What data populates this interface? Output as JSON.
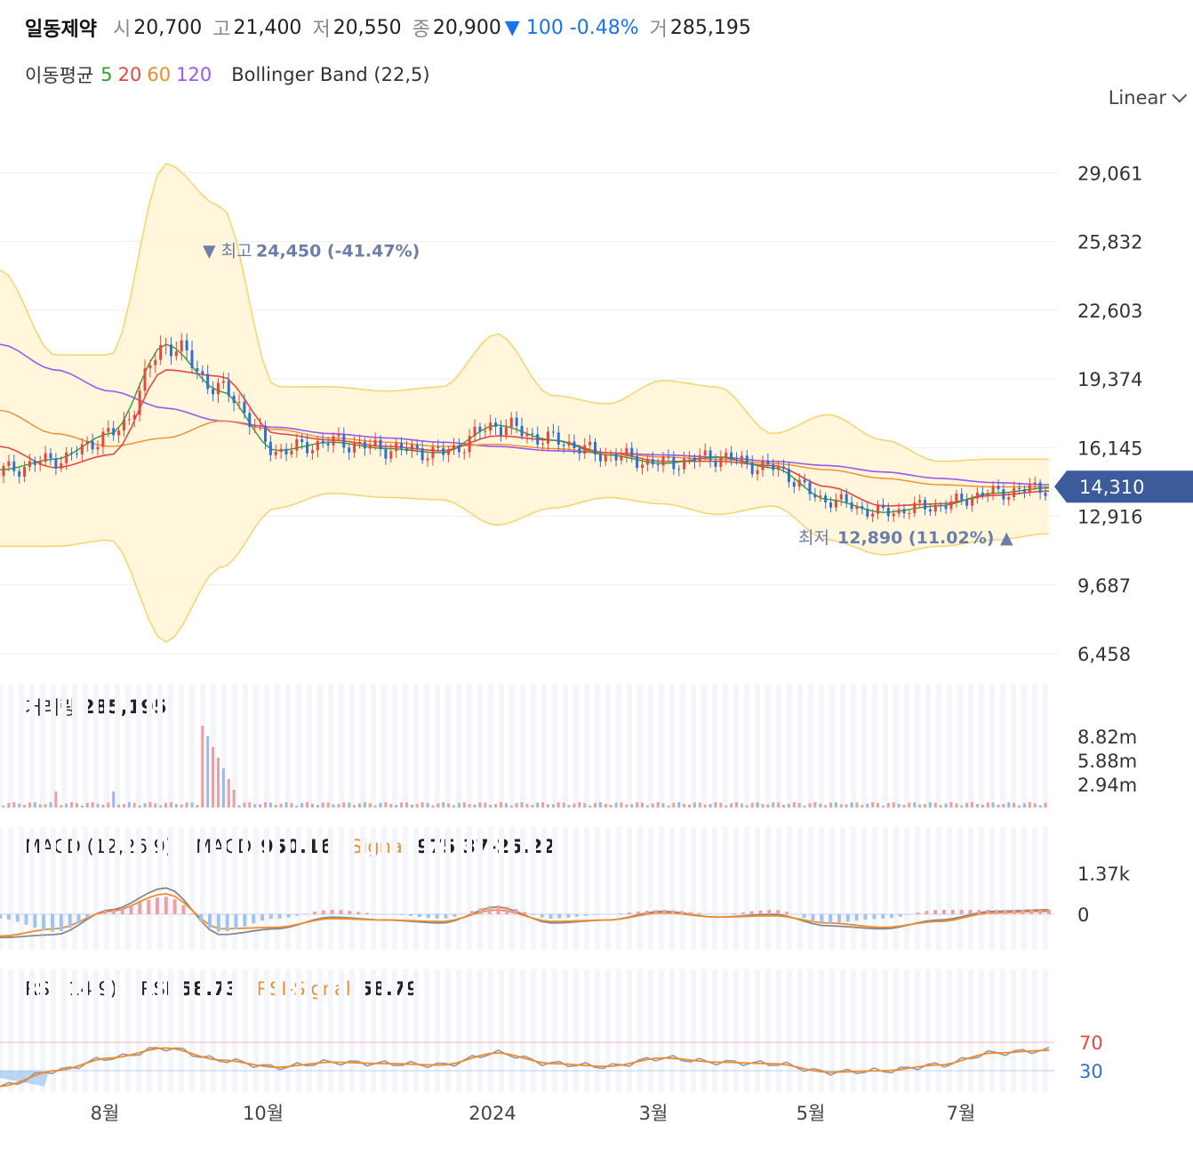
{
  "header": {
    "name": "일동제약",
    "open_label": "시",
    "open": "20,700",
    "high_label": "고",
    "high": "21,400",
    "low_label": "저",
    "low": "20,550",
    "close_label": "종",
    "close": "20,900",
    "change": "▼ 100 -0.48%",
    "volume_label": "거",
    "volume": "285,195"
  },
  "indicators": {
    "ma_label": "이동평균",
    "ma_periods": [
      "5",
      "20",
      "60",
      "120"
    ],
    "bollinger": "Bollinger Band (22,5)"
  },
  "scale_selector": "Linear",
  "colors": {
    "up": "#e8473f",
    "down": "#2f6fd6",
    "ma5": "#2ca02c",
    "ma20": "#e8473f",
    "ma60": "#f08c2d",
    "ma120": "#9b59e8",
    "band_fill": "#fff4d6",
    "band_line": "#f7d36a",
    "macd": "#888888",
    "signal": "#f08c2d",
    "price_tag": "#3d5a9a"
  },
  "annotations": {
    "high_label": "▼ 최고",
    "high_value": "24,450 (-41.47%)",
    "low_label": "최저",
    "low_value": "12,890 (11.02%) ▲"
  },
  "current_price_tag": "14,310",
  "price_axis_ticks": [
    "29,061",
    "25,832",
    "22,603",
    "19,374",
    "16,145",
    "12,916",
    "9,687",
    "6,458"
  ],
  "volume_panel": {
    "label": "거래량",
    "value": "285,195",
    "ticks": [
      "8.82m",
      "5.88m",
      "2.94m"
    ]
  },
  "macd_panel": {
    "label": "MACD (12,26,9)",
    "macd_label": "MACD",
    "macd_value": "950.16",
    "signal_label": "Signal",
    "signal_value": "975.37-25.22",
    "ticks": [
      "1.37k",
      "0"
    ]
  },
  "rsi_panel": {
    "label": "RSI (14,9)",
    "rsi_label": "RSI",
    "rsi_value": "58.73",
    "signal_label": "RSI-Signal",
    "signal_value": "58.79",
    "ticks": [
      "70",
      "30"
    ]
  },
  "x_axis_ticks": [
    "8월",
    "10월",
    "2024",
    "3월",
    "5월",
    "7월"
  ],
  "chart_data": {
    "type": "candlestick",
    "x": [
      "8월",
      "10월",
      "2024",
      "3월",
      "5월",
      "7월"
    ],
    "series": [
      {
        "name": "close",
        "values": [
          14800,
          15500,
          17200,
          22000,
          18500,
          15800,
          16400,
          16100,
          15900,
          17300,
          16600,
          15700,
          15400,
          15800,
          15200,
          13600,
          13000,
          13400,
          14000,
          14310
        ]
      },
      {
        "name": "120",
        "values": [
          21000,
          19800,
          18800,
          18000,
          17400,
          17100,
          16800,
          16600,
          16400,
          16200,
          16000,
          15900,
          15800,
          15700,
          15500,
          15300,
          15000,
          14700,
          14500,
          14400
        ]
      },
      {
        "name": "60",
        "values": [
          17900,
          16800,
          16200,
          16600,
          17400,
          17000,
          16600,
          16400,
          16200,
          16300,
          16100,
          15900,
          15700,
          15600,
          15400,
          15100,
          14700,
          14400,
          14300,
          14300
        ]
      },
      {
        "name": "20",
        "values": [
          16200,
          15200,
          15800,
          19800,
          19500,
          16800,
          16500,
          16200,
          16000,
          16700,
          16500,
          15900,
          15500,
          15500,
          15300,
          14300,
          13400,
          13500,
          13900,
          14100
        ]
      },
      {
        "name": "5",
        "values": [
          15100,
          15600,
          16800,
          21000,
          18800,
          16000,
          16400,
          16100,
          15900,
          17200,
          16500,
          15800,
          15400,
          15700,
          15200,
          13700,
          13100,
          13400,
          14000,
          14250
        ]
      },
      {
        "name": "band_upper",
        "values": [
          24500,
          20500,
          20500,
          29500,
          27500,
          19000,
          19000,
          18800,
          19000,
          21500,
          18600,
          18200,
          19300,
          19000,
          16800,
          17700,
          16500,
          15500,
          15600,
          15600
        ]
      },
      {
        "name": "band_lower",
        "values": [
          11500,
          11500,
          11800,
          7000,
          10500,
          13300,
          14000,
          13800,
          13700,
          12500,
          13300,
          13800,
          13500,
          13000,
          13400,
          11800,
          11100,
          11500,
          11800,
          12100
        ]
      },
      {
        "name": "macd",
        "values": [
          -800,
          -700,
          150,
          900,
          -700,
          -500,
          -100,
          -200,
          -300,
          250,
          -300,
          -200,
          100,
          -100,
          0,
          -400,
          -500,
          -200,
          100,
          150
        ]
      },
      {
        "name": "signal",
        "values": [
          -750,
          -500,
          100,
          700,
          -500,
          -450,
          -150,
          -200,
          -250,
          150,
          -250,
          -200,
          50,
          -100,
          -50,
          -300,
          -450,
          -250,
          50,
          100
        ]
      },
      {
        "name": "rsi",
        "values": [
          8,
          30,
          48,
          62,
          45,
          35,
          42,
          40,
          38,
          55,
          40,
          36,
          48,
          42,
          40,
          28,
          30,
          38,
          55,
          58.73
        ]
      }
    ],
    "ylim": [
      6458,
      30500
    ],
    "annotations": [
      {
        "label": "최고",
        "value": 24450,
        "x": "10월"
      },
      {
        "label": "최저",
        "value": 12890,
        "x": "7월"
      }
    ]
  }
}
